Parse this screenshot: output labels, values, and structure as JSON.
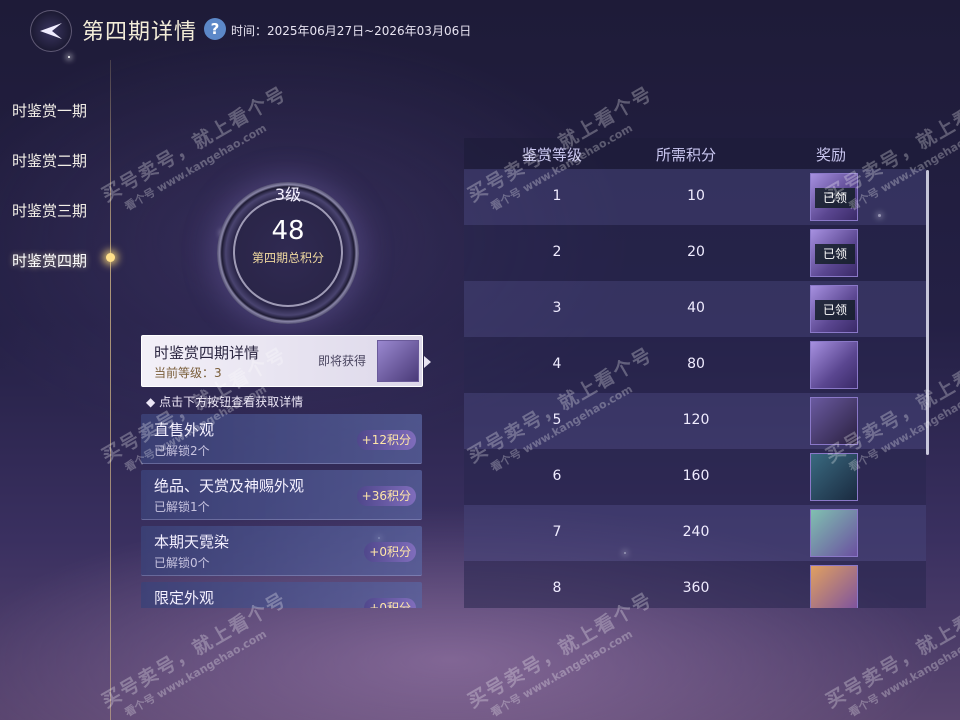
{
  "header": {
    "title": "第四期详情",
    "period": "时间：2025年06月27日~2026年03月06日",
    "help": "?"
  },
  "sidebar": {
    "items": [
      {
        "label": "时鉴赏一期"
      },
      {
        "label": "时鉴赏二期"
      },
      {
        "label": "时鉴赏三期"
      },
      {
        "label": "时鉴赏四期",
        "active": true
      }
    ]
  },
  "score": {
    "level": "3级",
    "total": "48",
    "label": "第四期总积分"
  },
  "detail_card": {
    "title": "时鉴赏四期详情",
    "level": "当前等级：3",
    "next_reward": "即将获得"
  },
  "hint": "点击下方按钮查看获取详情",
  "sources": [
    {
      "title": "直售外观",
      "unlocked": "已解锁2个",
      "points": "+12积分"
    },
    {
      "title": "绝品、天赏及神赐外观",
      "unlocked": "已解锁1个",
      "points": "+36积分"
    },
    {
      "title": "本期天霓染",
      "unlocked": "已解锁0个",
      "points": "+0积分"
    },
    {
      "title": "限定外观",
      "unlocked": "",
      "points": "+0积分"
    }
  ],
  "table": {
    "headers": [
      "鉴赏等级",
      "所需积分",
      "奖励"
    ],
    "rows": [
      {
        "level": "1",
        "points": "10",
        "status": "已领"
      },
      {
        "level": "2",
        "points": "20",
        "status": "已领"
      },
      {
        "level": "3",
        "points": "40",
        "status": "已领"
      },
      {
        "level": "4",
        "points": "80",
        "status": ""
      },
      {
        "level": "5",
        "points": "120",
        "status": ""
      },
      {
        "level": "6",
        "points": "160",
        "status": ""
      },
      {
        "level": "7",
        "points": "240",
        "status": ""
      },
      {
        "level": "8",
        "points": "360",
        "status": ""
      }
    ]
  },
  "watermark": {
    "main": "买号卖号，就上看个号",
    "sub": "看个号  www.kangehao.com"
  },
  "colors": {
    "accent_gold": "#ffe08a",
    "points_badge_text": "#ffe6a8",
    "header_text": "#c9c6f0"
  }
}
